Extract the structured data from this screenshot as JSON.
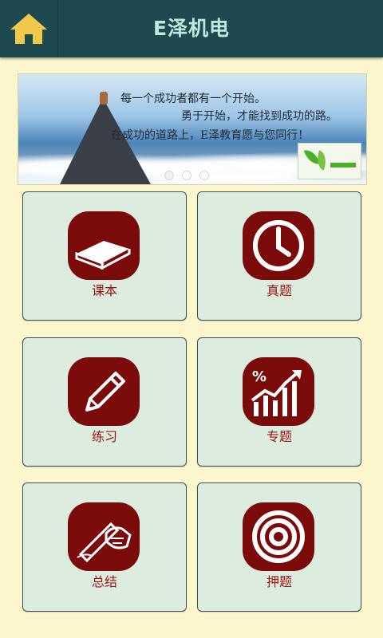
{
  "header": {
    "title": "E泽机电",
    "home_icon": "home-icon"
  },
  "banner": {
    "lines": [
      "每一个成功者都有一个开始。",
      "勇于开始，才能找到成功的路。",
      "在成功的道路上，E泽教育愿与您同行！"
    ],
    "slides_count": 3,
    "active_slide": 1
  },
  "grid": {
    "items": [
      {
        "label": "课本",
        "icon": "book-icon"
      },
      {
        "label": "真题",
        "icon": "clock-icon"
      },
      {
        "label": "练习",
        "icon": "pencil-icon"
      },
      {
        "label": "专题",
        "icon": "trend-chart-icon"
      },
      {
        "label": "总结",
        "icon": "writing-hand-icon"
      },
      {
        "label": "押题",
        "icon": "target-icon"
      }
    ]
  },
  "colors": {
    "header_bg": "#1e4a4f",
    "title_text": "#bfe9e0",
    "page_bg": "#fcf6cc",
    "card_bg": "#dcecdf",
    "icon_tile": "#7b0a0a",
    "label_text": "#9a1414",
    "home_icon": "#f2c84b"
  }
}
